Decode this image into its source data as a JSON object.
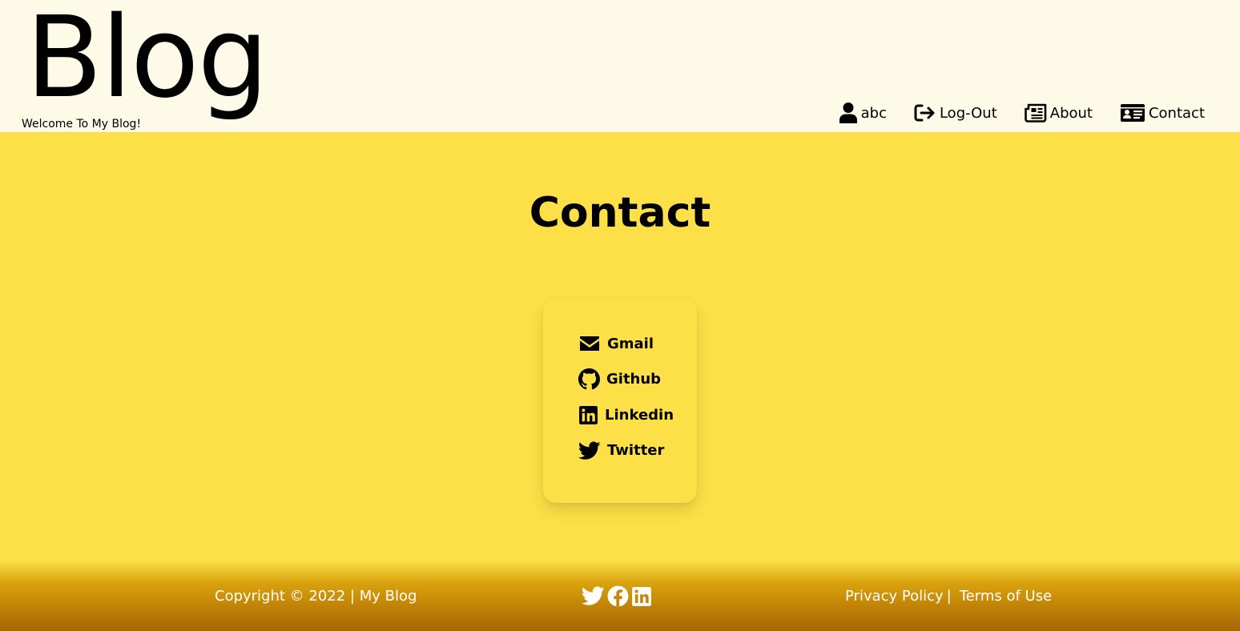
{
  "header": {
    "brand": "Blog",
    "tagline": "Welcome To My Blog!",
    "nav": {
      "user_label": "abc",
      "logout_label": "Log-Out",
      "about_label": "About",
      "contact_label": "Contact"
    }
  },
  "main": {
    "title": "Contact",
    "contacts": [
      {
        "label": "Gmail",
        "icon": "envelope-icon"
      },
      {
        "label": "Github",
        "icon": "github-icon"
      },
      {
        "label": "Linkedin",
        "icon": "linkedin-icon"
      },
      {
        "label": "Twitter",
        "icon": "twitter-icon"
      }
    ]
  },
  "footer": {
    "copyright": "Copyright © 2022 | My Blog",
    "social_icons": [
      "twitter-icon",
      "facebook-icon",
      "linkedin-icon"
    ],
    "privacy_label": "Privacy Policy",
    "separator": "|",
    "terms_label": "Terms of Use"
  },
  "colors": {
    "header_bg": "#fefae8",
    "main_bg": "#fde047",
    "footer_gradient_end": "#a86605",
    "text": "#000000",
    "footer_text": "#ffffff"
  }
}
